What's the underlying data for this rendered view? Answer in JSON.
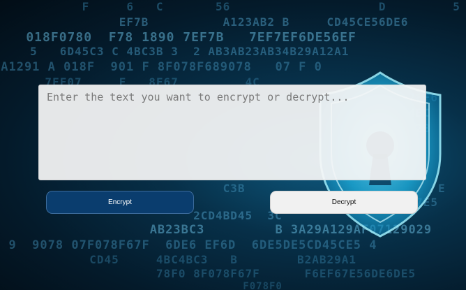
{
  "editor": {
    "placeholder": "Enter the text you want to encrypt or decrypt...",
    "value": ""
  },
  "actions": {
    "encrypt_label": "Encrypt",
    "decrypt_label": "Decrypt"
  },
  "colors": {
    "encrypt_button": "#0a3d6e",
    "decrypt_button": "#f1f1f1",
    "background": "#052338",
    "shield_glow": "#18b8e8"
  },
  "icons": {
    "background_shield": "shield-keyhole-icon"
  }
}
